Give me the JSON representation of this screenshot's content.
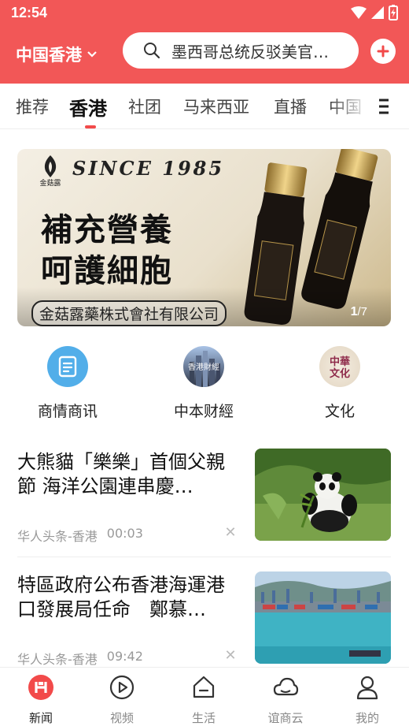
{
  "status_bar": {
    "time": "12:54"
  },
  "header": {
    "region": "中国香港",
    "search_text": "墨西哥总统反驳美官…"
  },
  "tabs": [
    {
      "label": "推荐",
      "active": false
    },
    {
      "label": "香港",
      "active": true
    },
    {
      "label": "社团",
      "active": false
    },
    {
      "label": "马来西亚",
      "active": false
    },
    {
      "label": "直播",
      "active": false
    },
    {
      "label": "中国",
      "active": false
    }
  ],
  "banner": {
    "brand": "SINCE 1985",
    "line1": "補充營養",
    "line2": "呵護細胞",
    "company": "金菇露藥株式會社有限公司",
    "logo_text": "金菇露",
    "counter_current": "1",
    "counter_total": "/7"
  },
  "quick_entries": [
    {
      "label": "商情商讯",
      "icon": "document-icon"
    },
    {
      "label": "中本财經",
      "icon": "city-icon",
      "overlay": "香港財經"
    },
    {
      "label": "文化",
      "icon": "culture-icon",
      "overlay": "中華文化"
    }
  ],
  "news": [
    {
      "title": "大熊貓「樂樂」首個父親節 海洋公園連串慶…",
      "source": "华人头条-香港",
      "time": "00:03",
      "thumb": "panda-photo"
    },
    {
      "title": "特區政府公布香港海運港口發展局任命　鄭慕…",
      "source": "华人头条-香港",
      "time": "09:42",
      "thumb": "harbor-photo"
    }
  ],
  "bottom_nav": [
    {
      "label": "新闻",
      "icon": "news-icon",
      "active": true
    },
    {
      "label": "视频",
      "icon": "video-icon",
      "active": false
    },
    {
      "label": "生活",
      "icon": "home-icon",
      "active": false
    },
    {
      "label": "谊商云",
      "icon": "cloud-icon",
      "active": false
    },
    {
      "label": "我的",
      "icon": "profile-icon",
      "active": false
    }
  ],
  "colors": {
    "brand_red": "#f25757",
    "accent_red": "#f24a4a",
    "quick_blue": "#52aee9"
  }
}
